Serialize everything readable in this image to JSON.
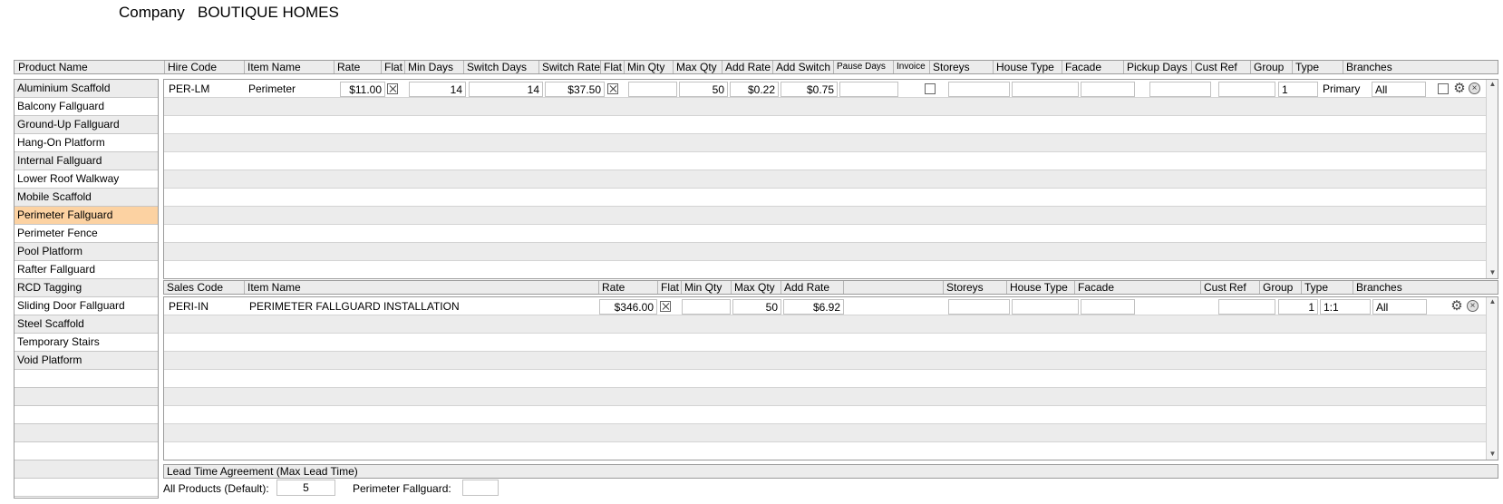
{
  "company": {
    "label": "Company",
    "name": "BOUTIQUE HOMES"
  },
  "product_header": "Product Name",
  "hire_headers": {
    "hire_code": "Hire Code",
    "item_name": "Item Name",
    "rate": "Rate",
    "flat": "Flat",
    "min_days": "Min Days",
    "switch_days": "Switch Days",
    "switch_rate": "Switch Rate",
    "flat2": "Flat",
    "min_qty": "Min Qty",
    "max_qty": "Max Qty",
    "add_rate": "Add Rate",
    "add_switch": "Add Switch",
    "pause_days": "Pause Days",
    "invoice": "Invoice",
    "storeys": "Storeys",
    "house_type": "House Type",
    "facade": "Facade",
    "pickup_days": "Pickup Days",
    "cust_ref": "Cust Ref",
    "group": "Group",
    "type": "Type",
    "branches": "Branches"
  },
  "products": [
    "Aluminium Scaffold",
    "Balcony Fallguard",
    "Ground-Up Fallguard",
    "Hang-On Platform",
    "Internal Fallguard",
    "Lower Roof Walkway",
    "Mobile Scaffold",
    "Perimeter Fallguard",
    "Perimeter Fence",
    "Pool Platform",
    "Rafter Fallguard",
    "RCD Tagging",
    "Sliding Door Fallguard",
    "Steel Scaffold",
    "Temporary Stairs",
    "Void Platform"
  ],
  "selected_product": "Perimeter Fallguard",
  "hire_row": {
    "hire_code": "PER-LM",
    "item_name": "Perimeter",
    "rate": "$11.00",
    "flat": true,
    "min_days": "14",
    "switch_days": "14",
    "switch_rate": "$37.50",
    "flat2": true,
    "min_qty": "",
    "max_qty": "50",
    "add_rate": "$0.22",
    "add_switch": "$0.75",
    "pause_days": "",
    "invoice": false,
    "storeys": "",
    "house_type": "",
    "facade": "",
    "pickup_days": "",
    "cust_ref": "",
    "group": "1",
    "type": "Primary",
    "branches": "All"
  },
  "sales_headers": {
    "sales_code": "Sales Code",
    "item_name": "Item Name",
    "rate": "Rate",
    "flat": "Flat",
    "min_qty": "Min Qty",
    "max_qty": "Max Qty",
    "add_rate": "Add Rate",
    "storeys": "Storeys",
    "house_type": "House Type",
    "facade": "Facade",
    "cust_ref": "Cust Ref",
    "group": "Group",
    "type": "Type",
    "branches": "Branches"
  },
  "sales_row": {
    "sales_code": "PERI-IN",
    "item_name": "PERIMETER FALLGUARD INSTALLATION",
    "rate": "$346.00",
    "flat": true,
    "min_qty": "",
    "max_qty": "50",
    "add_rate": "$6.92",
    "storeys": "",
    "house_type": "",
    "facade": "",
    "cust_ref": "",
    "group": "1",
    "type": "1:1",
    "branches": "All"
  },
  "lead_time": {
    "title": "Lead Time Agreement (Max Lead Time)",
    "default_label": "All Products (Default):",
    "default_value": "5",
    "perimeter_label": "Perimeter Fallguard:",
    "perimeter_value": ""
  },
  "icons": {
    "settings": "gear-icon",
    "remove": "close-circle-icon"
  },
  "colors": {
    "selected_row": "#fcd2a2",
    "alt_row": "#ececec",
    "header": "#ececec"
  }
}
